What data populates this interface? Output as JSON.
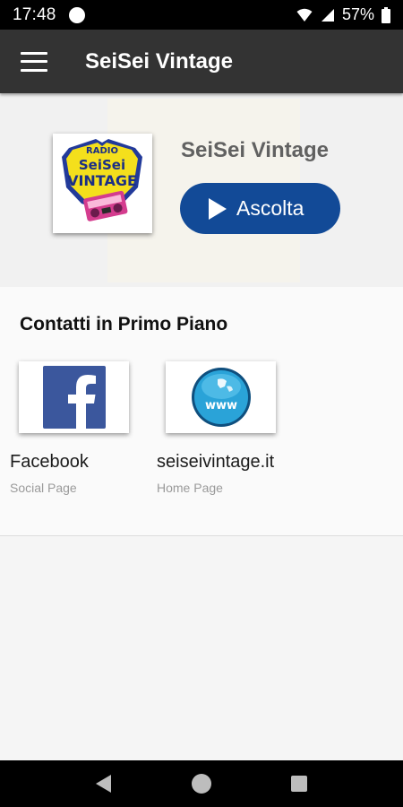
{
  "status_bar": {
    "time": "17:48",
    "battery_percent": "57%",
    "icons": [
      "notification-dot-icon",
      "wifi-icon",
      "signal-icon",
      "battery-icon"
    ]
  },
  "app_bar": {
    "title": "SeiSei Vintage",
    "menu_icon": "hamburger-menu-icon"
  },
  "player": {
    "station_name": "SeiSei Vintage",
    "play_label": "Ascolta",
    "play_color": "#124a97",
    "logo_text": {
      "top": "RADIO",
      "middle": "SeiSei",
      "bottom": "VINTAGE"
    }
  },
  "contacts": {
    "title": "Contatti in Primo Piano",
    "items": [
      {
        "name": "Facebook",
        "subtitle": "Social Page",
        "icon": "facebook-icon"
      },
      {
        "name": "seiseivintage.it",
        "subtitle": "Home Page",
        "icon": "globe-www-icon"
      }
    ],
    "www_text": "www"
  },
  "nav_bar": {
    "icons": [
      "back-icon",
      "home-icon",
      "recent-apps-icon"
    ]
  }
}
